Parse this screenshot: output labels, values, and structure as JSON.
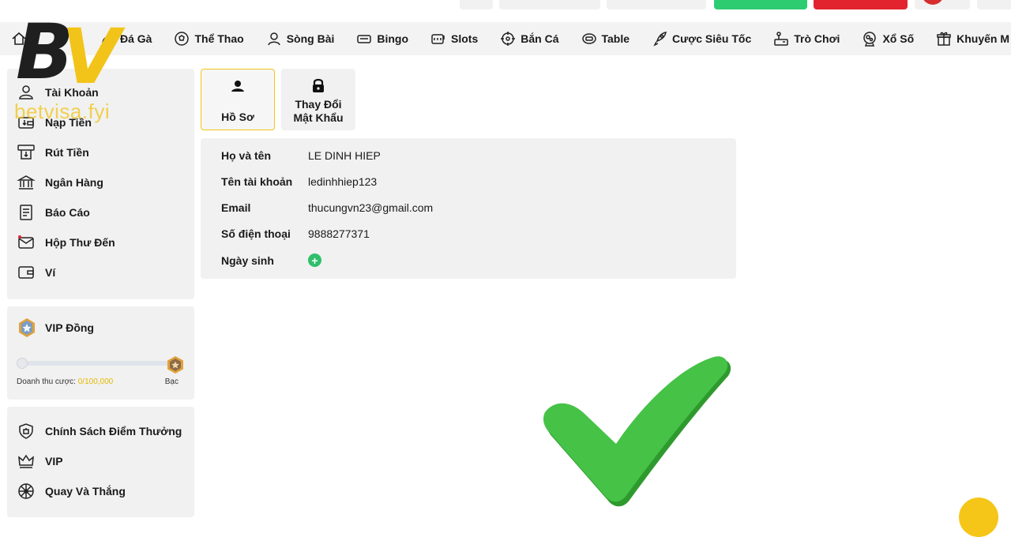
{
  "logo": {
    "text_b": "B",
    "text_v": "V",
    "url": "betvisa.fyi"
  },
  "nav": {
    "items": [
      {
        "label": "Đá Gà",
        "icon": "rooster-icon"
      },
      {
        "label": "Thể Thao",
        "icon": "soccer-ball-icon"
      },
      {
        "label": "Sòng Bài",
        "icon": "dealer-icon"
      },
      {
        "label": "Bingo",
        "icon": "bingo-icon"
      },
      {
        "label": "Slots",
        "icon": "slot-machine-icon"
      },
      {
        "label": "Bắn Cá",
        "icon": "crosshair-icon"
      },
      {
        "label": "Table",
        "icon": "table-game-icon"
      },
      {
        "label": "Cược Siêu Tốc",
        "icon": "rocket-icon"
      },
      {
        "label": "Trò Chơi",
        "icon": "arcade-icon"
      },
      {
        "label": "Xổ Số",
        "icon": "lottery-icon"
      },
      {
        "label": "Khuyến M",
        "icon": "gift-icon"
      }
    ]
  },
  "sidebar": {
    "items": [
      {
        "label": "Tài Khoản",
        "icon": "user-icon"
      },
      {
        "label": "Nạp Tiền",
        "icon": "deposit-wallet-icon"
      },
      {
        "label": "Rút Tiền",
        "icon": "withdraw-icon"
      },
      {
        "label": "Ngân Hàng",
        "icon": "bank-icon"
      },
      {
        "label": "Báo Cáo",
        "icon": "report-icon"
      },
      {
        "label": "Hộp Thư Đến",
        "icon": "mail-icon"
      },
      {
        "label": "Ví",
        "icon": "wallet-icon"
      }
    ]
  },
  "vip": {
    "title": "VIP Đồng",
    "progress_label": "Doanh thu cược:",
    "progress_amount": "0/100,000",
    "progress": 0,
    "next_level": "Bạc"
  },
  "bottom_menu": {
    "items": [
      {
        "label": "Chính Sách Điểm Thưởng",
        "icon": "reward-policy-icon"
      },
      {
        "label": "VIP",
        "icon": "crown-icon"
      },
      {
        "label": "Quay Và Thắng",
        "icon": "spin-wheel-icon"
      }
    ]
  },
  "tabs": [
    {
      "line1": "",
      "line2": "Hồ Sơ",
      "icon": "person-icon",
      "active": true
    },
    {
      "line1": "Thay Đổi",
      "line2": "Mật Khẩu",
      "icon": "lock-icon",
      "active": false
    }
  ],
  "profile": {
    "fields": [
      {
        "label": "Họ và tên",
        "value": "LE DINH HIEP"
      },
      {
        "label": "Tên tài khoản",
        "value": "ledinhhiep123"
      },
      {
        "label": "Email",
        "value": "thucungvn23@gmail.com"
      },
      {
        "label": "Số điện thoại",
        "value": "9888277371"
      },
      {
        "label": "Ngày sinh",
        "value": ""
      }
    ]
  },
  "colors": {
    "accent": "#f2c41a",
    "panel": "#f1f1f1",
    "success": "#2fbf6a",
    "danger": "#e2242f",
    "check": "#3cba3c"
  }
}
